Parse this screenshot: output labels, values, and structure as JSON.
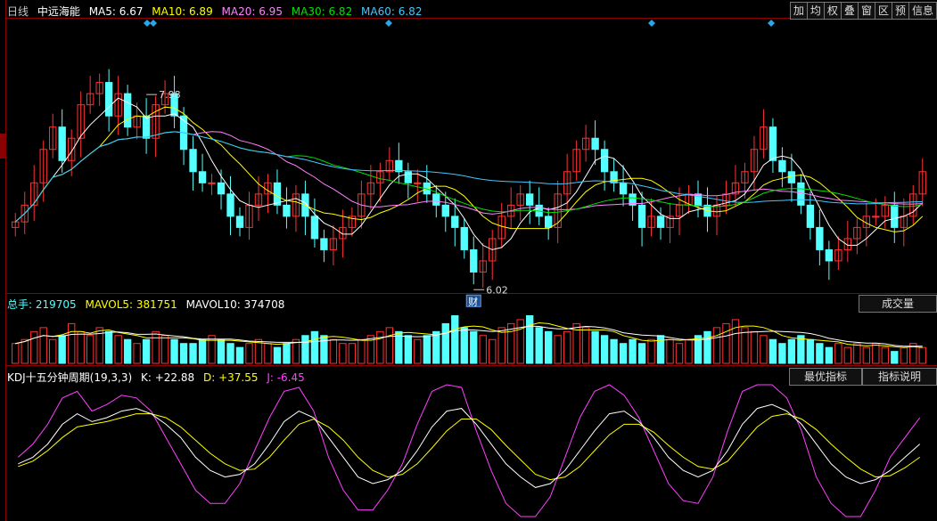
{
  "header": {
    "period": "日线",
    "stock": "中远海能",
    "ma5": "MA5: 6.67",
    "ma10": "MA10: 6.89",
    "ma20": "MA20: 6.95",
    "ma30": "MA30: 6.82",
    "ma60": "MA60: 6.82"
  },
  "toolbar": [
    "加",
    "均",
    "权",
    "叠",
    "窗",
    "区",
    "预",
    "信息"
  ],
  "price_labels": {
    "high": "7.98",
    "low": "6.02",
    "badge": "财"
  },
  "volume": {
    "total": "总手: 219705",
    "mavol5": "MAVOL5: 381751",
    "mavol10": "MAVOL10: 374708",
    "button": "成交量"
  },
  "kdj": {
    "name": "KDJ十五分钟周期(19,3,3)",
    "k": "K: +22.88",
    "d": "D: +37.55",
    "j": "J: -6.45",
    "best_button": "最优指标",
    "explain_button": "指标说明"
  },
  "colors": {
    "up": "#ff3232",
    "down": "#54ffff",
    "ma5": "#ffffff",
    "ma10": "#ffff00",
    "ma20": "#ff80ff",
    "ma30": "#00e000",
    "ma60": "#40c8ff",
    "j": "#ff40ff"
  },
  "chart_data": {
    "type": "candlestick",
    "price_range": [
      5.9,
      8.2
    ],
    "closes": [
      6.45,
      6.6,
      6.8,
      7.1,
      7.3,
      7.0,
      7.2,
      7.5,
      7.6,
      7.7,
      7.4,
      7.6,
      7.3,
      7.4,
      7.2,
      7.5,
      7.6,
      7.4,
      7.1,
      6.9,
      6.8,
      6.8,
      6.7,
      6.5,
      6.4,
      6.6,
      6.7,
      6.8,
      6.6,
      6.5,
      6.7,
      6.5,
      6.3,
      6.2,
      6.3,
      6.4,
      6.5,
      6.7,
      6.8,
      6.9,
      7.0,
      6.9,
      6.8,
      6.8,
      6.7,
      6.6,
      6.5,
      6.4,
      6.2,
      6.0,
      6.1,
      6.3,
      6.5,
      6.6,
      6.7,
      6.6,
      6.5,
      6.4,
      6.7,
      6.9,
      7.1,
      7.2,
      7.1,
      6.9,
      6.8,
      6.7,
      6.6,
      6.4,
      6.5,
      6.4,
      6.5,
      6.6,
      6.7,
      6.6,
      6.5,
      6.6,
      6.7,
      6.8,
      6.9,
      7.1,
      7.3,
      7.0,
      6.9,
      6.8,
      6.6,
      6.4,
      6.2,
      6.1,
      6.2,
      6.3,
      6.4,
      6.5,
      6.5,
      6.6,
      6.4,
      6.5,
      6.7,
      6.9
    ],
    "markers": {
      "diamonds": [
        165,
        172,
        436,
        731,
        865
      ],
      "high_index": 14,
      "low_index": 49
    },
    "volume": [
      5,
      6,
      8,
      9,
      6,
      7,
      10,
      8,
      7,
      9,
      8,
      7,
      6,
      5,
      6,
      8,
      7,
      6,
      5,
      5,
      6,
      7,
      6,
      5,
      4,
      5,
      6,
      5,
      4,
      5,
      6,
      7,
      8,
      7,
      6,
      5,
      5,
      6,
      7,
      8,
      9,
      8,
      7,
      6,
      7,
      8,
      10,
      12,
      9,
      8,
      7,
      6,
      9,
      10,
      11,
      12,
      9,
      8,
      7,
      8,
      10,
      9,
      8,
      7,
      6,
      5,
      6,
      5,
      6,
      7,
      6,
      5,
      6,
      7,
      8,
      9,
      10,
      11,
      9,
      8,
      7,
      6,
      5,
      6,
      7,
      6,
      5,
      4,
      5,
      4,
      5,
      4,
      5,
      4,
      3,
      4,
      5,
      4
    ],
    "kdj": {
      "k": [
        40,
        45,
        55,
        70,
        78,
        72,
        75,
        80,
        82,
        78,
        70,
        60,
        45,
        35,
        30,
        32,
        40,
        55,
        72,
        80,
        75,
        60,
        45,
        30,
        25,
        28,
        35,
        50,
        68,
        80,
        82,
        70,
        55,
        40,
        30,
        22,
        25,
        35,
        50,
        65,
        78,
        80,
        72,
        60,
        45,
        35,
        30,
        35,
        50,
        70,
        82,
        85,
        80,
        70,
        55,
        40,
        30,
        25,
        28,
        35,
        45,
        55
      ],
      "d": [
        38,
        42,
        50,
        60,
        68,
        70,
        72,
        75,
        78,
        78,
        75,
        68,
        58,
        48,
        40,
        35,
        36,
        45,
        58,
        70,
        74,
        68,
        58,
        45,
        35,
        30,
        32,
        40,
        52,
        65,
        74,
        74,
        66,
        54,
        43,
        32,
        28,
        30,
        38,
        50,
        62,
        70,
        70,
        64,
        54,
        45,
        38,
        36,
        42,
        55,
        68,
        76,
        78,
        74,
        66,
        55,
        45,
        36,
        30,
        31,
        37,
        45
      ],
      "j": [
        45,
        55,
        70,
        90,
        95,
        80,
        85,
        92,
        90,
        80,
        60,
        40,
        20,
        10,
        10,
        25,
        50,
        75,
        95,
        98,
        80,
        45,
        20,
        5,
        5,
        20,
        40,
        70,
        95,
        100,
        98,
        65,
        35,
        10,
        0,
        0,
        15,
        45,
        75,
        95,
        100,
        92,
        75,
        50,
        25,
        12,
        10,
        30,
        65,
        95,
        100,
        100,
        90,
        65,
        30,
        10,
        0,
        0,
        20,
        45,
        60,
        75
      ]
    }
  }
}
